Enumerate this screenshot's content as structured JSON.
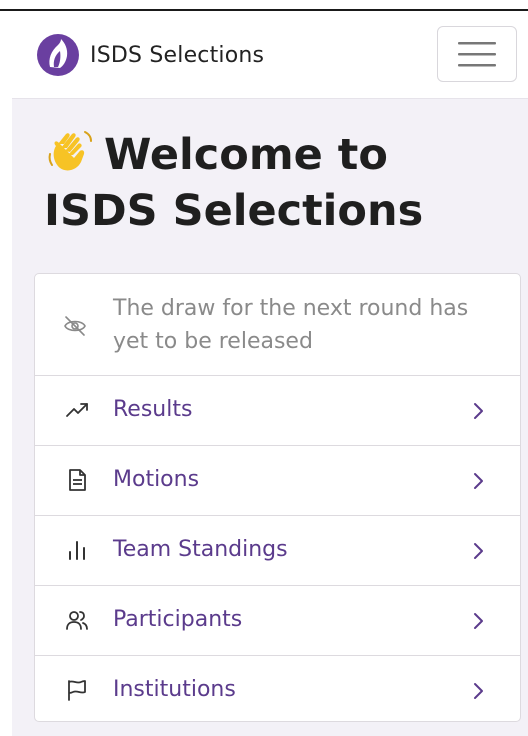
{
  "navbar": {
    "brand_text": "ISDS Selections",
    "logo_icon": "isds-logo-icon",
    "menu_icon": "hamburger-menu-icon"
  },
  "main": {
    "heading_icon": "waving-hand-icon",
    "heading_text": "Welcome to ISDS Selections"
  },
  "notice": {
    "icon": "eye-off-icon",
    "text": "The draw for the next round has yet to be released"
  },
  "links": [
    {
      "label": "Results",
      "icon": "trending-up-icon"
    },
    {
      "label": "Motions",
      "icon": "document-icon"
    },
    {
      "label": "Team Standings",
      "icon": "bar-chart-icon"
    },
    {
      "label": "Participants",
      "icon": "users-icon"
    },
    {
      "label": "Institutions",
      "icon": "flag-icon"
    }
  ],
  "colors": {
    "accent": "#5b3b8c",
    "logo_purple": "#6a3fa0",
    "background": "#f3f1f7",
    "muted_text": "#8a8a8a"
  }
}
